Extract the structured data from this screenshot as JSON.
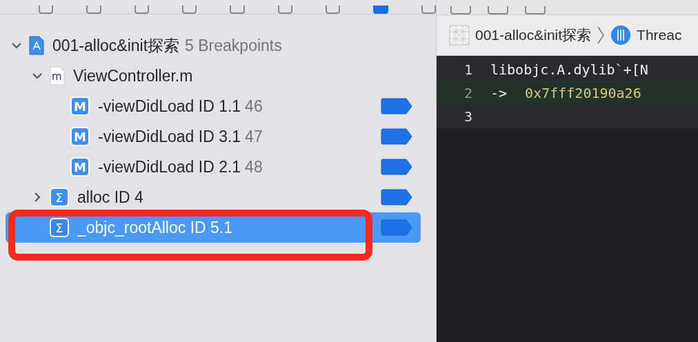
{
  "navigator": {
    "items": [
      {
        "kind": "project",
        "label": "001-alloc&init探索",
        "count": "5 Breakpoints",
        "expanded": true,
        "selected": false,
        "children": [
          {
            "kind": "file",
            "badge": "m",
            "label": "ViewController.m",
            "expanded": true,
            "selected": false,
            "children": [
              {
                "kind": "method",
                "badge": "M",
                "label": "-viewDidLoad  ID 1.1",
                "line": "46",
                "selected": false
              },
              {
                "kind": "method",
                "badge": "M",
                "label": "-viewDidLoad  ID 3.1",
                "line": "47",
                "selected": false
              },
              {
                "kind": "method",
                "badge": "M",
                "label": "-viewDidLoad  ID 2.1",
                "line": "48",
                "selected": false
              }
            ]
          },
          {
            "kind": "symbol",
            "badge": "Σ",
            "label": "alloc ID 4",
            "expanded": false,
            "selected": false
          },
          {
            "kind": "symbol",
            "badge": "Σ",
            "label": "_objc_rootAlloc  ID 5.1",
            "selected": true
          }
        ]
      }
    ]
  },
  "editor": {
    "breadcrumb": [
      {
        "kind": "project",
        "label": "001-alloc&init探索"
      },
      {
        "kind": "thread",
        "label": "Threac"
      }
    ],
    "lines": [
      {
        "number": "1",
        "text": "libobjc.A.dylib`+[N",
        "current": false
      },
      {
        "number": "2",
        "arrow": "->",
        "text": "0x7fff20190a26",
        "current": true
      },
      {
        "number": "3",
        "current": false
      }
    ]
  }
}
